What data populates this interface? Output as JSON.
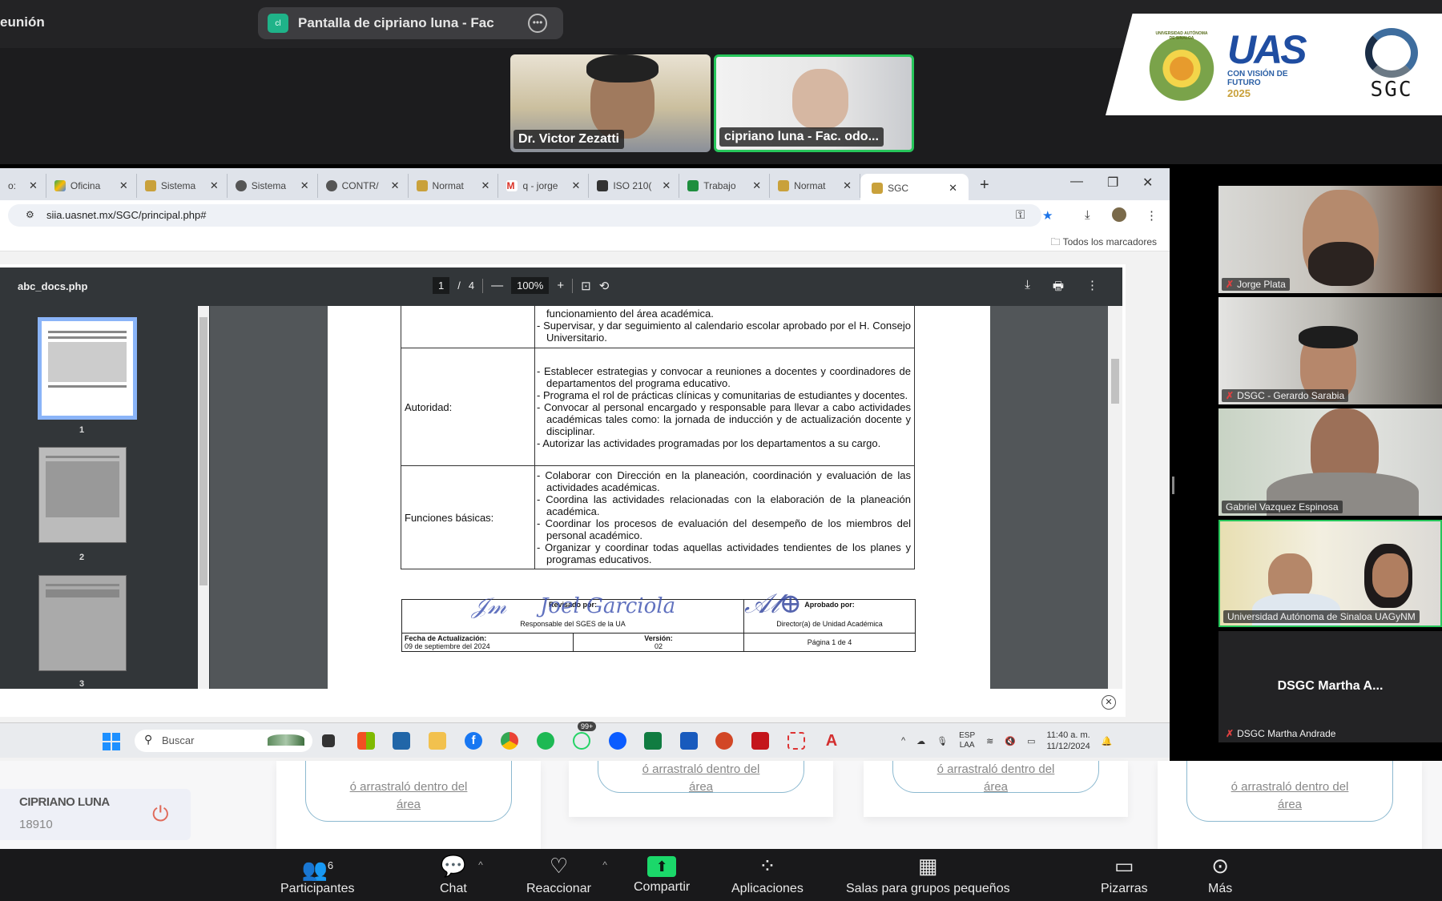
{
  "meeting": {
    "label_partial": "eunión",
    "share_pill": {
      "badge": "cl",
      "text": "Pantalla de cipriano luna - Fac"
    },
    "banner": {
      "seal_text": "UNIVERSIDAD AUTÓNOMA DE SINALOA",
      "uas": "UAS",
      "slogan_1": "CON VISIÓN DE",
      "slogan_2": "FUTURO",
      "year": "2025",
      "sgc": "SGC"
    },
    "top_videos": [
      {
        "name": "Dr. Victor Zezatti",
        "active": false
      },
      {
        "name": "cipriano luna - Fac. odo...",
        "active": true
      }
    ],
    "gallery": [
      {
        "name": "Jorge Plata",
        "muted": true
      },
      {
        "name": "DSGC - Gerardo Sarabia",
        "muted": true
      },
      {
        "name": "Gabriel Vazquez Espinosa",
        "muted": false
      },
      {
        "name": "Universidad Autónoma de Sinaloa UAGyNM",
        "muted": false,
        "active": true
      },
      {
        "name": "DSGC Martha Andrade",
        "display": "DSGC Martha A...",
        "muted": true,
        "video_off": true
      }
    ]
  },
  "browser": {
    "tabs": [
      {
        "title": "o:",
        "icon": "page"
      },
      {
        "title": "Oficina",
        "icon": "drive"
      },
      {
        "title": "Sistema",
        "icon": "uas"
      },
      {
        "title": "Sistema",
        "icon": "globe"
      },
      {
        "title": "CONTR/",
        "icon": "globe"
      },
      {
        "title": "Normat",
        "icon": "uas"
      },
      {
        "title": "q - jorge",
        "icon": "gmail"
      },
      {
        "title": "ISO 210(",
        "icon": "doc-dark"
      },
      {
        "title": "Trabajo",
        "icon": "classroom"
      },
      {
        "title": "Normat",
        "icon": "uas"
      },
      {
        "title": "SGC",
        "icon": "uas",
        "active": true
      }
    ],
    "url": "siia.uasnet.mx/SGC/principal.php#",
    "bookmarks_label": "Todos los marcadores"
  },
  "pdf": {
    "filename": "abc_docs.php",
    "current_page": "1",
    "total_pages": "4",
    "zoom": "100%",
    "thumb_numbers": [
      "1",
      "2",
      "3"
    ],
    "rows": [
      {
        "label": "",
        "items": [
          "funcionamiento del área académica.",
          "- Supervisar, y dar seguimiento al calendario escolar aprobado por el H. Consejo Universitario."
        ]
      },
      {
        "label": "Autoridad:",
        "items": [
          "- Establecer estrategias y convocar a reuniones a docentes y coordinadores de departamentos del programa educativo.",
          "- Programa el rol de prácticas clínicas y comunitarias de estudiantes y docentes.",
          "- Convocar al personal encargado y responsable para llevar a cabo actividades académicas tales como: la jornada de inducción y de actualización docente y disciplinar.",
          "- Autorizar las actividades programadas por los departamentos a su cargo."
        ]
      },
      {
        "label": "Funciones básicas:",
        "items": [
          "- Colaborar con Dirección en la planeación, coordinación y evaluación de las actividades académicas.",
          "- Coordina las actividades relacionadas con la elaboración de la planeación académica.",
          "- Coordinar los procesos de evaluación del desempeño de los miembros del personal académico.",
          "- Organizar y coordinar todas aquellas actividades tendientes de los planes y programas educativos."
        ]
      }
    ],
    "footer": {
      "reviewed_label": "Revisado por:",
      "reviewed_role": "Responsable del SGES de la UA",
      "approved_label": "Aprobado por:",
      "approved_role": "Director(a) de Unidad Académica",
      "date_label": "Fecha de Actualización:",
      "date_value": "09 de septiembre del 2024",
      "version_label": "Versión:",
      "version_value": "02",
      "page_label": "Página 1 de 4",
      "signature_text": "Joel Garciola"
    }
  },
  "taskbar": {
    "search_placeholder": "Buscar",
    "whatsapp_badge": "99+",
    "lang_1": "ESP",
    "lang_2": "LAA",
    "time": "11:40 a. m.",
    "date": "11/12/2024"
  },
  "website": {
    "user_name": "CIPRIANO LUNA",
    "user_id": "18910",
    "drop_text": "ó arrastraló dentro del",
    "drop_text_2": "área"
  },
  "zoom_toolbar": {
    "participants_label": "Participantes",
    "participants_count": "6",
    "chat_label": "Chat",
    "react_label": "Reaccionar",
    "share_label": "Compartir",
    "apps_label": "Aplicaciones",
    "breakout_label": "Salas para grupos pequeños",
    "whiteboards_label": "Pizarras",
    "more_label": "Más"
  },
  "colors": {
    "zoom_green": "#1bd86a",
    "active_speaker": "#27c65b",
    "pdf_toolbar": "#323639",
    "thumb_selected": "#8ab4f8"
  }
}
